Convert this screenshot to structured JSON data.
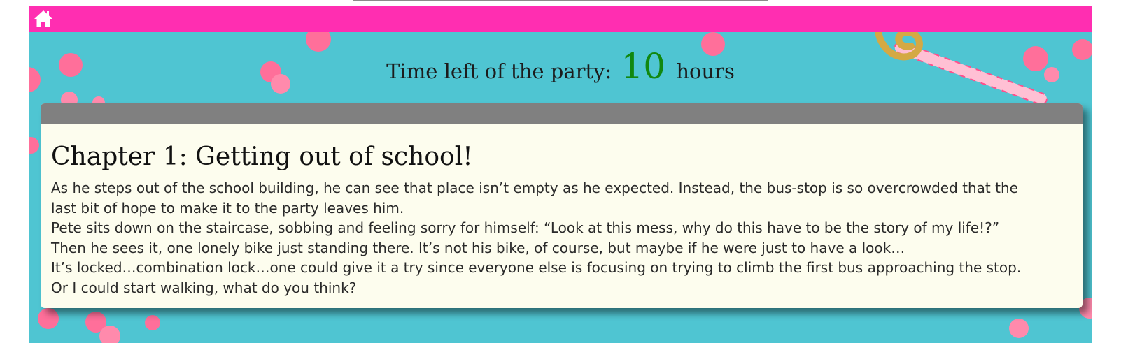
{
  "nav": {
    "home_icon": "home-icon",
    "color": "#ff2eb1"
  },
  "timer": {
    "prefix": "Time left of the party:",
    "value": "10",
    "suffix": "hours",
    "value_color": "#11880f"
  },
  "chapter": {
    "title": "Chapter 1: Getting out of school!",
    "lines": [
      "As he steps out of the school building, he can see that place isn’t empty as he expected. Instead, the bus-stop is so overcrowded that the",
      "last bit of hope to make it to the party leaves him.",
      "Pete sits down on the staircase, sobbing and feeling sorry for himself: “Look at this mess, why do this have to be the story of my life!?”",
      "Then he sees it, one lonely bike just standing there. It’s not his bike, of course, but maybe if he were just to have a look…",
      "It’s locked…combination lock…one could give it a try since everyone else is focusing on trying to climb the first bus approaching the stop.",
      "Or I could start walking, what do you think?"
    ]
  }
}
